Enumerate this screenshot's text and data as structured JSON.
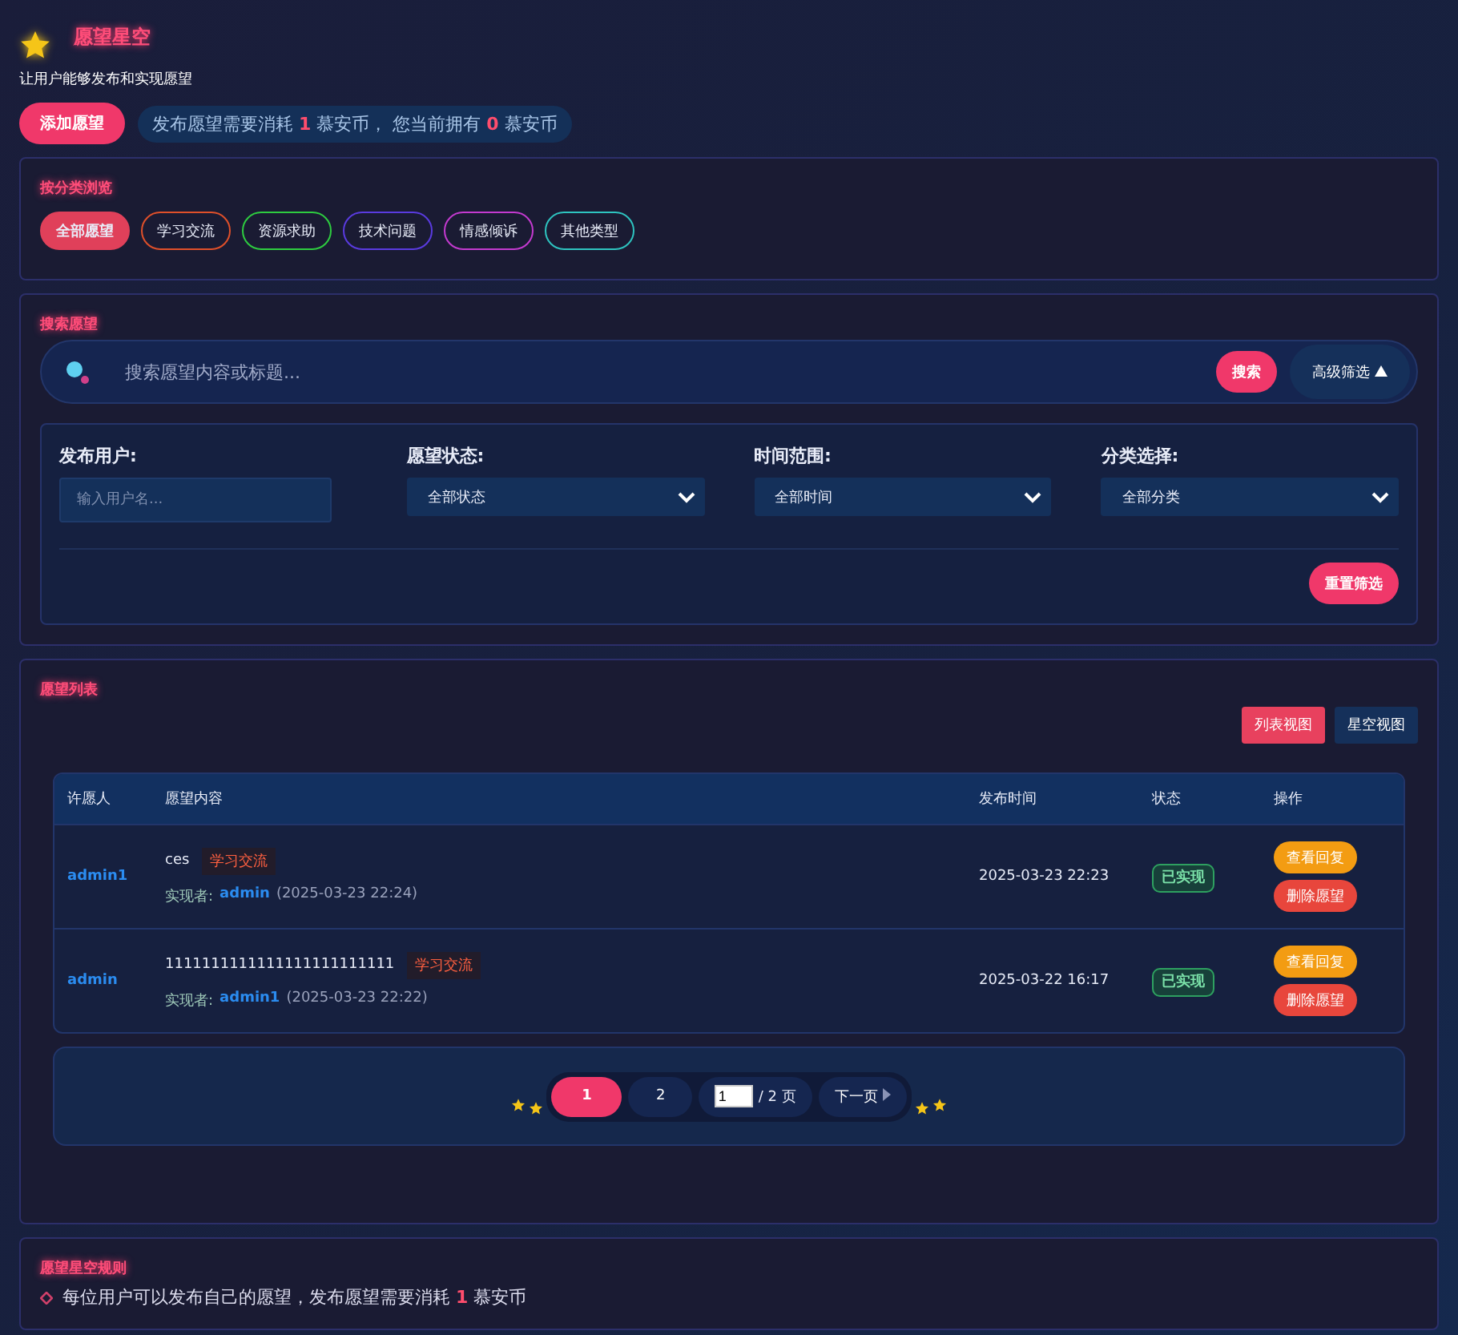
{
  "header": {
    "title": "愿望星空",
    "subtitle": "让用户能够发布和实现愿望"
  },
  "add_button": "添加愿望",
  "notice": [
    {
      "kind": "text",
      "text": "发布愿望需要消耗 "
    },
    {
      "kind": "number",
      "text": "1"
    },
    {
      "kind": "text",
      "text": " 慕安币， 您当前拥有 "
    },
    {
      "kind": "number",
      "text": "0"
    },
    {
      "kind": "text",
      "text": " 慕安币"
    }
  ],
  "categories": {
    "title": "按分类浏览",
    "items": [
      {
        "label": "全部愿望",
        "selected": true,
        "color": "#e0405a"
      },
      {
        "label": "学习交流",
        "selected": false,
        "color": "#e0502a"
      },
      {
        "label": "资源求助",
        "selected": false,
        "color": "#2ecc40"
      },
      {
        "label": "技术问题",
        "selected": false,
        "color": "#5a3be0"
      },
      {
        "label": "情感倾诉",
        "selected": false,
        "color": "#c43ad0"
      },
      {
        "label": "其他类型",
        "selected": false,
        "color": "#2ec4c0"
      }
    ]
  },
  "search": {
    "title": "搜索愿望",
    "placeholder": "搜索愿望内容或标题...",
    "search_button": "搜索",
    "advanced_button": "高级筛选",
    "advanced_expanded": true,
    "filters": [
      {
        "kind": "input",
        "label": "发布用户:",
        "placeholder": "输入用户名..."
      },
      {
        "kind": "select",
        "label": "愿望状态:",
        "value": "全部状态"
      },
      {
        "kind": "select",
        "label": "时间范围:",
        "value": "全部时间"
      },
      {
        "kind": "select",
        "label": "分类选择:",
        "value": "全部分类"
      }
    ],
    "reset_button": "重置筛选"
  },
  "list": {
    "title": "愿望列表",
    "views": [
      {
        "label": "列表视图",
        "selected": true
      },
      {
        "label": "星空视图",
        "selected": false
      }
    ],
    "columns": [
      "许愿人",
      "愿望内容",
      "发布时间",
      "状态",
      "操作"
    ],
    "rows": [
      {
        "user": "admin1",
        "content": "ces",
        "category": "学习交流",
        "realizer_label": "实现者:",
        "realizer": "admin",
        "realized_time": "(2025-03-23 22:24)",
        "time": "2025-03-23 22:23",
        "status": "已实现",
        "actions": [
          "查看回复",
          "删除愿望"
        ]
      },
      {
        "user": "admin",
        "content": "1111111111111111111111111",
        "category": "学习交流",
        "realizer_label": "实现者:",
        "realizer": "admin1",
        "realized_time": "(2025-03-23 22:22)",
        "time": "2025-03-22 16:17",
        "status": "已实现",
        "actions": [
          "查看回复",
          "删除愿望"
        ]
      }
    ],
    "pagination": {
      "pages": [
        {
          "label": "1",
          "selected": true
        },
        {
          "label": "2",
          "selected": false
        }
      ],
      "page_input": "1",
      "total": "/ 2 页",
      "next": "下一页"
    }
  },
  "rules": {
    "title": "愿望星空规则",
    "items": [
      [
        {
          "kind": "text",
          "text": "每位用户可以发布自己的愿望，发布愿望需要消耗 "
        },
        {
          "kind": "number",
          "text": "1"
        },
        {
          "kind": "text",
          "text": " 慕安币"
        }
      ]
    ]
  }
}
